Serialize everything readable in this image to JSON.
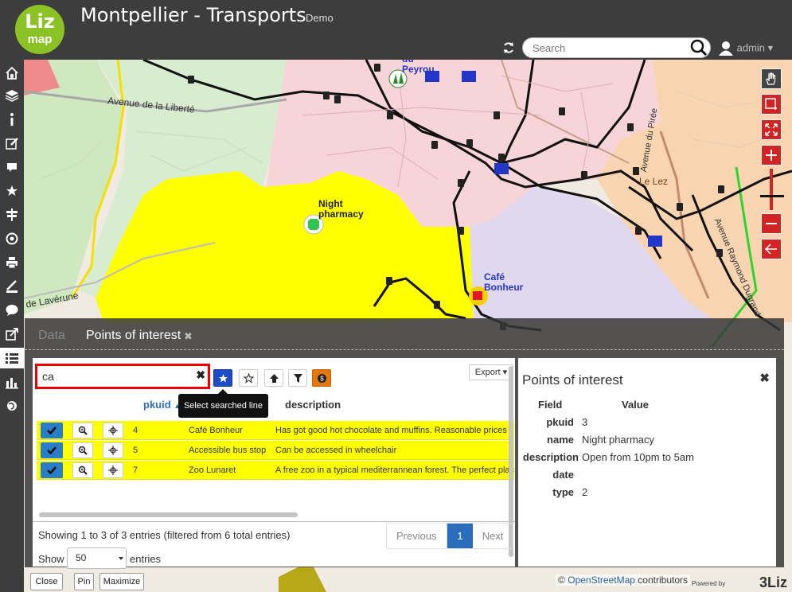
{
  "header": {
    "logo_top": "Liz",
    "logo_bottom": "map",
    "title": "Montpellier - Transports",
    "subtitle": "Demo",
    "search_placeholder": "Search",
    "user_name": "admin",
    "logo_color": "#8bc225"
  },
  "sidebar": {
    "items": [
      "home-icon",
      "layers-icon",
      "info-icon",
      "edit-icon",
      "chat-icon",
      "star-icon",
      "signpost-icon",
      "locate-icon",
      "print-icon",
      "measure-icon",
      "comment-icon",
      "share-icon",
      "list-icon",
      "chart-icon",
      "globe-icon"
    ],
    "active": "list-icon"
  },
  "map": {
    "labels": {
      "peyrou": "du\nPeyrou",
      "night_pharmacy": "Night\npharmacy",
      "cafe_bonheur": "Café\nBonheur",
      "le_lez": "Le Lez",
      "avenue_liberte": "Avenue de la Liberté",
      "avenue_piree": "Avenue du Pirée",
      "avenue_raymond": "Avenue Raymond Dugrand",
      "de_lavérune": "de Lavérune"
    },
    "attribution_prefix": "©",
    "attribution_link": "OpenStreetMap",
    "attribution_suffix": "contributors",
    "powered_by": "Powered by",
    "powered_brand": "3Liz",
    "accent_red": "#d32424"
  },
  "dock": {
    "tabs": [
      "Data",
      "Points of interest"
    ],
    "active_tab": "Points of interest",
    "filter_value": "ca",
    "tooltip": "Select searched line",
    "export_label": "Export",
    "columns": [
      "pkuid",
      "description"
    ],
    "rows": [
      {
        "pkuid": "4",
        "name": "Café Bonheur",
        "description": "Has got good hot chocolate and muffins. Reasonable prices"
      },
      {
        "pkuid": "5",
        "name": "Accessible bus stop",
        "description": "Can be accessed in wheelchair"
      },
      {
        "pkuid": "7",
        "name": "Zoo Lunaret",
        "description": "A free zoo in a typical mediterrannean forest. The perfect place"
      }
    ],
    "info": "Showing 1 to 3 of 3 entries (filtered from 6 total entries)",
    "pager": {
      "previous": "Previous",
      "current": "1",
      "next": "Next"
    },
    "show_label": "Show",
    "page_size": "50",
    "entries_label": "entries",
    "highlight_color": "#fefe00"
  },
  "feature": {
    "title": "Points of interest",
    "header_field": "Field",
    "header_value": "Value",
    "fields": [
      {
        "label": "pkuid",
        "value": "3"
      },
      {
        "label": "name",
        "value": "Night pharmacy"
      },
      {
        "label": "description",
        "value": "Open from 10pm to 5am"
      },
      {
        "label": "date",
        "value": ""
      },
      {
        "label": "type",
        "value": "2"
      }
    ]
  },
  "dock_buttons": {
    "close": "Close",
    "pin": "Pin",
    "maximize": "Maximize"
  }
}
